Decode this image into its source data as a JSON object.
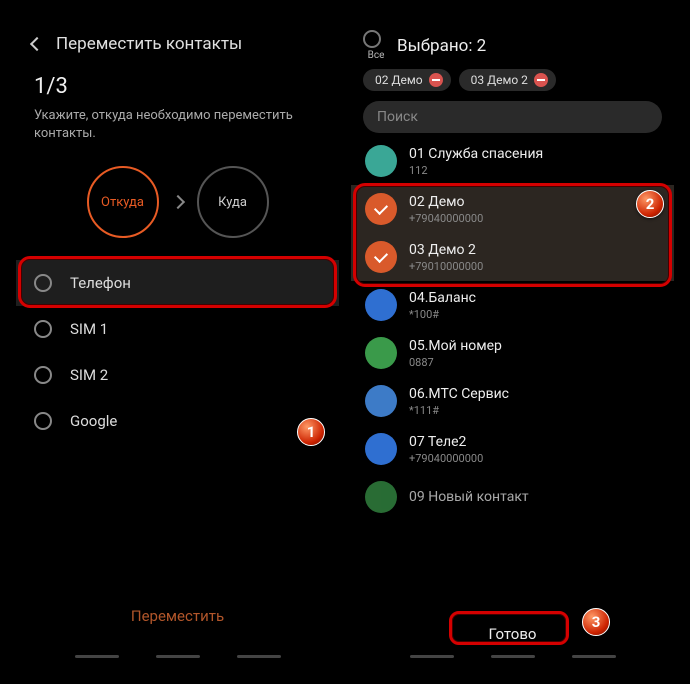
{
  "left": {
    "title": "Переместить контакты",
    "step": "1/3",
    "instruction": "Укажите, откуда необходимо переместить контакты.",
    "from_label": "Откуда",
    "to_label": "Куда",
    "sources": [
      {
        "label": "Телефон"
      },
      {
        "label": "SIM 1"
      },
      {
        "label": "SIM 2"
      },
      {
        "label": "Google"
      }
    ],
    "move_button": "Переместить"
  },
  "right": {
    "all_label": "Все",
    "selected_title": "Выбрано: 2",
    "chips": [
      {
        "label": "02 Демо"
      },
      {
        "label": "03 Демо 2"
      }
    ],
    "search_placeholder": "Поиск",
    "contacts": [
      {
        "name": "01 Служба спасения",
        "sub": "112",
        "color": "c-teal",
        "selected": false
      },
      {
        "name": "02 Демо",
        "sub": "+79040000000",
        "color": "check",
        "selected": true
      },
      {
        "name": "03 Демо 2",
        "sub": "+79010000000",
        "color": "check",
        "selected": true
      },
      {
        "name": "04.Баланс",
        "sub": "*100#",
        "color": "c-blue",
        "selected": false
      },
      {
        "name": "05.Мой номер",
        "sub": "0887",
        "color": "c-green",
        "selected": false
      },
      {
        "name": "06.МТС Сервис",
        "sub": "*111#",
        "color": "c-blue2",
        "selected": false
      },
      {
        "name": "07 Теле2",
        "sub": "+79040000000",
        "color": "c-blue",
        "selected": false
      },
      {
        "name": "09 Новый контакт",
        "sub": "",
        "color": "c-green",
        "selected": false
      }
    ],
    "done_button": "Готово"
  },
  "annotations": {
    "b1": "1",
    "b2": "2",
    "b3": "3"
  }
}
